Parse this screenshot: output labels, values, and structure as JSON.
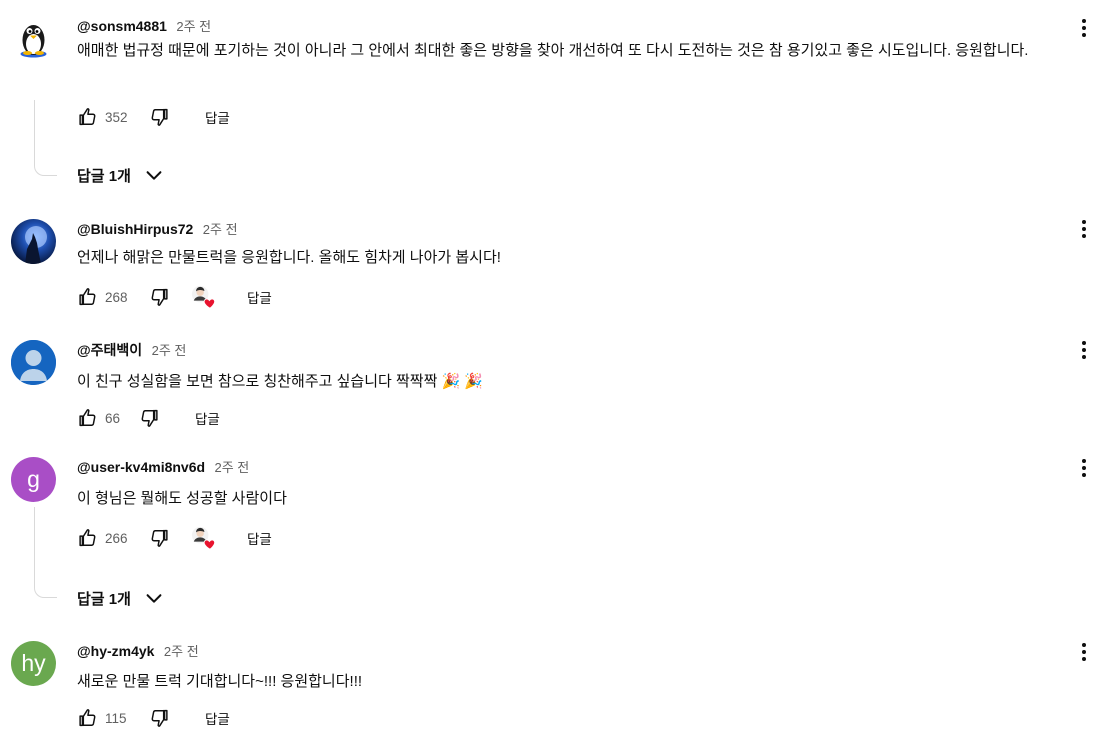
{
  "comments": [
    {
      "author": "@sonsm4881",
      "time": "2주 전",
      "text": "애매한 법규정 때문에 포기하는 것이 아니라 그 안에서 최대한 좋은 방향을 찾아 개선하여 또 다시 도전하는 것은 참 용기있고 좋은 시도입니다. 응원합니다.",
      "likes": "352",
      "reply_label": "답글",
      "avatar_icon": "penguin-avatar",
      "replies_label": "답글 1개"
    },
    {
      "author": "@BluishHirpus72",
      "time": "2주 전",
      "text": "언제나 해맑은 만물트럭을 응원합니다. 올해도 힘차게 나아가 봅시다!",
      "likes": "268",
      "reply_label": "답글",
      "avatar_icon": "wolf-moon-avatar",
      "creator_heart": true
    },
    {
      "author": "@주태백이",
      "time": "2주 전",
      "text": "이 친구 성실함을 보면 참으로 칭찬해주고 싶습니다 짝짝짝 🎉 🎉",
      "likes": "66",
      "reply_label": "답글",
      "avatar_icon": "default-person-avatar"
    },
    {
      "author": "@user-kv4mi8nv6d",
      "time": "2주 전",
      "text": "이 형님은 뭘해도 성공할 사람이다",
      "likes": "266",
      "reply_label": "답글",
      "avatar_letter": "g",
      "avatar_color": "#a94ec6",
      "creator_heart": true,
      "replies_label": "답글 1개"
    },
    {
      "author": "@hy-zm4yk",
      "time": "2주 전",
      "text": "새로운 만물 트럭 기대합니다~!!!  응원합니다!!!",
      "likes": "115",
      "reply_label": "답글",
      "avatar_letter": "hy",
      "avatar_color": "#6aa84f"
    }
  ],
  "colors": {
    "heart": "#e8132e",
    "secondary_text": "#606060",
    "default_avatar": "#1565c0"
  }
}
